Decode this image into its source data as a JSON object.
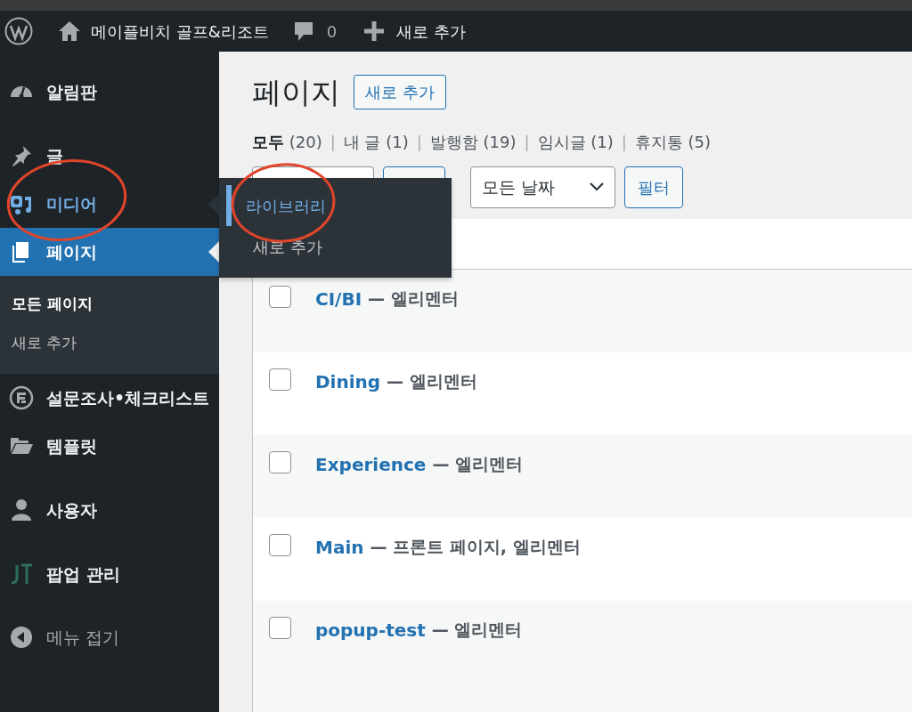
{
  "admin_bar": {
    "site_name": "메이플비치 골프&리조트",
    "comments": "0",
    "new_label": "새로 추가"
  },
  "sidebar": {
    "items": [
      {
        "label": "알림판",
        "selected": false,
        "hovered": false
      },
      {
        "label": "글",
        "selected": false,
        "hovered": false
      },
      {
        "label": "미디어",
        "selected": false,
        "hovered": true
      },
      {
        "label": "페이지",
        "selected": true,
        "hovered": false
      },
      {
        "label": "설문조사•체크리스트",
        "selected": false,
        "hovered": false
      },
      {
        "label": "템플릿",
        "selected": false,
        "hovered": false
      },
      {
        "label": "사용자",
        "selected": false,
        "hovered": false
      },
      {
        "label": "팝업 관리",
        "selected": false,
        "hovered": false
      }
    ],
    "submenu": [
      {
        "label": "모든 페이지",
        "selected": true
      },
      {
        "label": "새로 추가",
        "selected": false
      }
    ],
    "collapse_label": "메뉴 접기"
  },
  "flyout": [
    {
      "label": "라이브러리",
      "selected": true
    },
    {
      "label": "새로 추가",
      "selected": false
    }
  ],
  "main": {
    "title": "페이지",
    "add_new": "새로 추가",
    "views": [
      {
        "label": "모두",
        "count": "(20)",
        "selected": true
      },
      {
        "separator": "|",
        "label": "내 글",
        "count": "(1)",
        "selected": false
      },
      {
        "separator": "|",
        "label": "발행함",
        "count": "(19)",
        "selected": false
      },
      {
        "separator": "|",
        "label": "임시글",
        "count": "(1)",
        "selected": false
      },
      {
        "separator": "|",
        "label": "휴지통",
        "count": "(5)",
        "selected": false
      }
    ],
    "date_filter": "모든 날짜",
    "filter_button": "필터",
    "rows": [
      {
        "title": "CI/BI",
        "states": "— 엘리멘터",
        "checked": false
      },
      {
        "title": "Dining",
        "states": "— 엘리멘터",
        "checked": false
      },
      {
        "title": "Experience",
        "states": "— 엘리멘터",
        "checked": false
      },
      {
        "title": "Main",
        "states": "— 프론트 페이지, 엘리멘터",
        "checked": false
      },
      {
        "title": "popup-test",
        "states": "— 엘리멘터",
        "checked": false
      }
    ]
  },
  "annotations": [
    {
      "kind": "ellipse",
      "color": "#e0452b"
    },
    {
      "kind": "ellipse",
      "color": "#e0452b"
    }
  ]
}
